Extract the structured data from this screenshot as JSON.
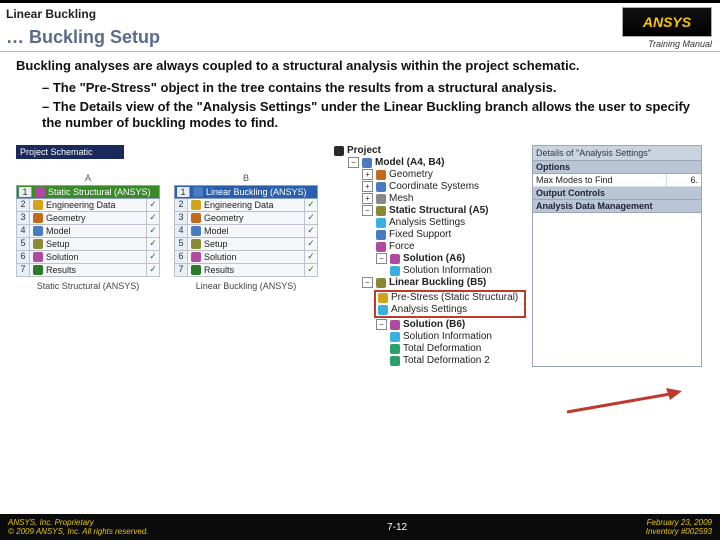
{
  "header": {
    "title1": "Linear Buckling",
    "title2": "… Buckling Setup",
    "logo_text": "ANSYS",
    "training": "Training Manual"
  },
  "intro": "Buckling analyses are always coupled to a structural analysis within the project schematic.",
  "bullets": [
    "The \"Pre-Stress\" object in the tree contains the results from a structural analysis.",
    "The Details view of the \"Analysis Settings\" under the Linear Buckling branch allows the user to specify the number of buckling modes to find."
  ],
  "schematic": {
    "title": "Project Schematic",
    "columns": [
      {
        "col_letter": "A",
        "head": "Static Structural (ANSYS)",
        "style": "green",
        "rows": [
          {
            "n": "2",
            "label": "Engineering Data",
            "mark": "✓"
          },
          {
            "n": "3",
            "label": "Geometry",
            "mark": "✓"
          },
          {
            "n": "4",
            "label": "Model",
            "mark": "✓"
          },
          {
            "n": "5",
            "label": "Setup",
            "mark": "✓"
          },
          {
            "n": "6",
            "label": "Solution",
            "mark": "✓"
          },
          {
            "n": "7",
            "label": "Results",
            "mark": "✓"
          }
        ],
        "foot": "Static Structural (ANSYS)"
      },
      {
        "col_letter": "B",
        "head": "Linear Buckling (ANSYS)",
        "style": "blue",
        "rows": [
          {
            "n": "2",
            "label": "Engineering Data",
            "mark": "✓"
          },
          {
            "n": "3",
            "label": "Geometry",
            "mark": "✓"
          },
          {
            "n": "4",
            "label": "Model",
            "mark": "✓"
          },
          {
            "n": "5",
            "label": "Setup",
            "mark": "✓"
          },
          {
            "n": "6",
            "label": "Solution",
            "mark": "✓"
          },
          {
            "n": "7",
            "label": "Results",
            "mark": "✓"
          }
        ],
        "foot": "Linear Buckling (ANSYS)"
      }
    ]
  },
  "tree": {
    "root": "Project",
    "model": "Model (A4, B4)",
    "items": [
      "Geometry",
      "Coordinate Systems",
      "Mesh"
    ],
    "static": {
      "name": "Static Structural (A5)",
      "children": [
        "Analysis Settings",
        "Fixed Support",
        "Force"
      ],
      "solution": "Solution (A6)",
      "sol_children": [
        "Solution Information"
      ]
    },
    "buckling": {
      "name": "Linear Buckling (B5)",
      "highlight": [
        "Pre-Stress (Static Structural)",
        "Analysis Settings"
      ],
      "solution": "Solution (B6)",
      "sol_children": [
        "Solution Information",
        "Total Deformation",
        "Total Deformation 2"
      ]
    }
  },
  "details": {
    "title": "Details of \"Analysis Settings\"",
    "groups": [
      {
        "name": "Options",
        "rows": [
          {
            "k": "Max Modes to Find",
            "v": "6."
          }
        ]
      },
      {
        "name": "Output Controls",
        "rows": []
      },
      {
        "name": "Analysis Data Management",
        "rows": []
      }
    ]
  },
  "footer": {
    "left1": "ANSYS, Inc. Proprietary",
    "left2": "© 2009 ANSYS, Inc. All rights reserved.",
    "center": "7-12",
    "right1": "February 23, 2009",
    "right2": "Inventory #002593"
  }
}
